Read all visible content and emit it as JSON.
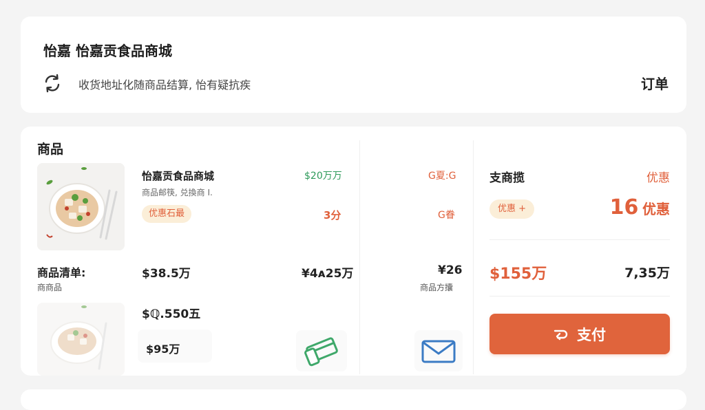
{
  "header": {
    "store_title": "怡嘉 怡嘉贡食品商城",
    "address_text": "收货地址化随商品结算, 怡有疑抗疾",
    "orders_link": "订单",
    "refresh_icon": "refresh-icon"
  },
  "main": {
    "section_title": "商品",
    "product": {
      "name": "怡嘉贡食品商城",
      "desc": "商品邮筷, 兑換商 I.",
      "promo": "优惠石最",
      "price": "$20万万",
      "qty": "3分",
      "col3_top": "G夏:G",
      "col3_mid": "G眷"
    },
    "list": {
      "label": "商品清单:",
      "sub": "商商品",
      "v1": "$38.5万",
      "v2": "¥4ᴀ25万",
      "v3": "¥26",
      "v3_sub": "商品方攮"
    },
    "item2": {
      "price": "$ℚ.550五",
      "total": "$95万"
    },
    "icons": {
      "wallet": "wallet-icon",
      "mail": "mail-icon"
    }
  },
  "summary": {
    "title": "支商揽",
    "discount_label": "优惠",
    "discount_chip": "优惠 +",
    "discount_value_num": "16",
    "discount_value_unit": "优惠",
    "total_price": "$155万",
    "total_secondary": "7,35万",
    "pay_label": "支付",
    "pay_icon": "arrow-return-icon"
  },
  "colors": {
    "accent": "#e0643c",
    "green": "#2e9a5a",
    "chip_bg": "#fbeed8",
    "page_bg": "#f4f4f4"
  }
}
